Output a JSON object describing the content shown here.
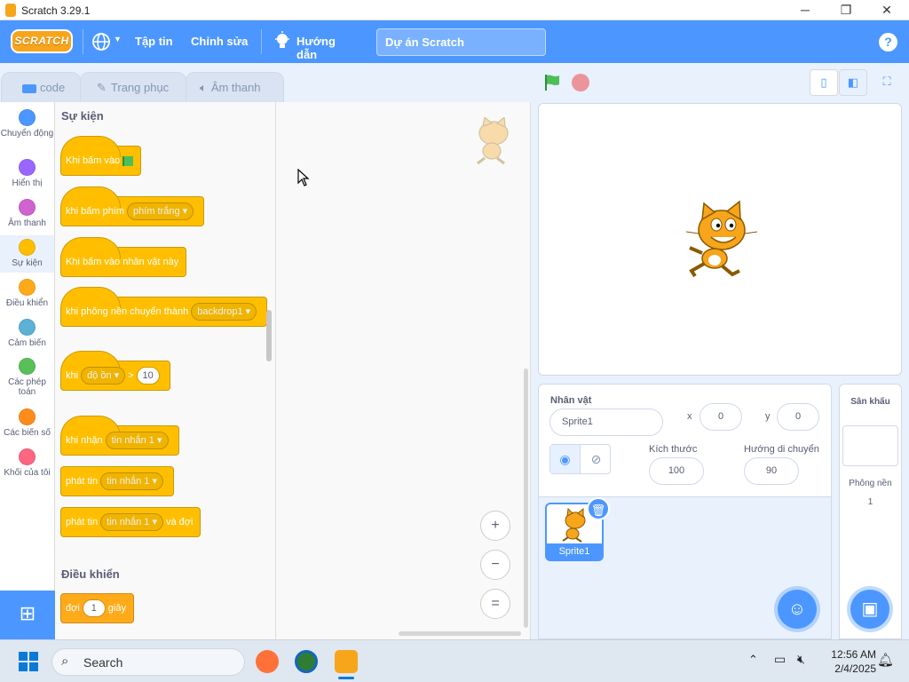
{
  "window": {
    "title": "Scratch 3.29.1",
    "minimize": "─",
    "maximize": "❐",
    "close": "✕"
  },
  "menubar": {
    "logo": "SCRATCH",
    "language_icon": "globe-icon",
    "file": "Tập tin",
    "edit": "Chỉnh sửa",
    "tutorials": "Hướng dẫn",
    "project_title": "Dự án Scratch",
    "help": "?"
  },
  "tabs": {
    "code": "code",
    "costumes": "Trang phục",
    "sounds": "Âm thanh"
  },
  "categories": [
    {
      "label": "Chuyển động",
      "color": "#4c97ff"
    },
    {
      "label": "Hiển thị",
      "color": "#9966ff"
    },
    {
      "label": "Âm thanh",
      "color": "#cf63cf"
    },
    {
      "label": "Sự kiện",
      "color": "#ffbf00"
    },
    {
      "label": "Điều khiển",
      "color": "#ffab19"
    },
    {
      "label": "Cảm biến",
      "color": "#5cb1d6"
    },
    {
      "label": "Các phép toán",
      "color": "#59c059"
    },
    {
      "label": "Các biến số",
      "color": "#ff8c1a"
    },
    {
      "label": "Khối của tôi",
      "color": "#ff6680"
    }
  ],
  "palette": {
    "events_title": "Sự kiện",
    "control_title": "Điều khiển",
    "blocks": {
      "when_flag": "Khi bấm vào",
      "when_key": "khi bấm phím",
      "key_option": "phím trắng",
      "when_sprite_clicked": "Khi bấm vào nhân vật này",
      "when_backdrop": "khi phông nền chuyển thành",
      "backdrop_option": "backdrop1",
      "when_gt_prefix": "khi",
      "gt_option": "độ ồn",
      "gt_symbol": ">",
      "gt_value": "10",
      "when_receive": "khi nhận",
      "message_option": "tin nhắn 1",
      "broadcast": "phát tin",
      "broadcast_option": "tin nhắn 1",
      "broadcast_wait": "phát tin",
      "broadcast_wait_option": "tin nhắn 1",
      "broadcast_wait_suffix": "và đợi",
      "wait": "đợi",
      "wait_value": "1",
      "wait_suffix": "giây"
    }
  },
  "zoom": {
    "in": "+",
    "out": "−",
    "reset": "="
  },
  "sprite_info": {
    "sprite_label": "Nhân vật",
    "sprite_name": "Sprite1",
    "x_label": "x",
    "x_value": "0",
    "y_label": "y",
    "y_value": "0",
    "show_label": "Hiển thị",
    "size_label": "Kích thước",
    "size_value": "100",
    "direction_label": "Hướng di chuyển",
    "direction_value": "90"
  },
  "sprites": [
    {
      "name": "Sprite1"
    }
  ],
  "stage_panel": {
    "title": "Sân khấu",
    "backdrops_label": "Phông nền",
    "backdrops_count": "1"
  },
  "taskbar": {
    "search": "Search",
    "time": "12:56 AM",
    "date": "2/4/2025"
  }
}
